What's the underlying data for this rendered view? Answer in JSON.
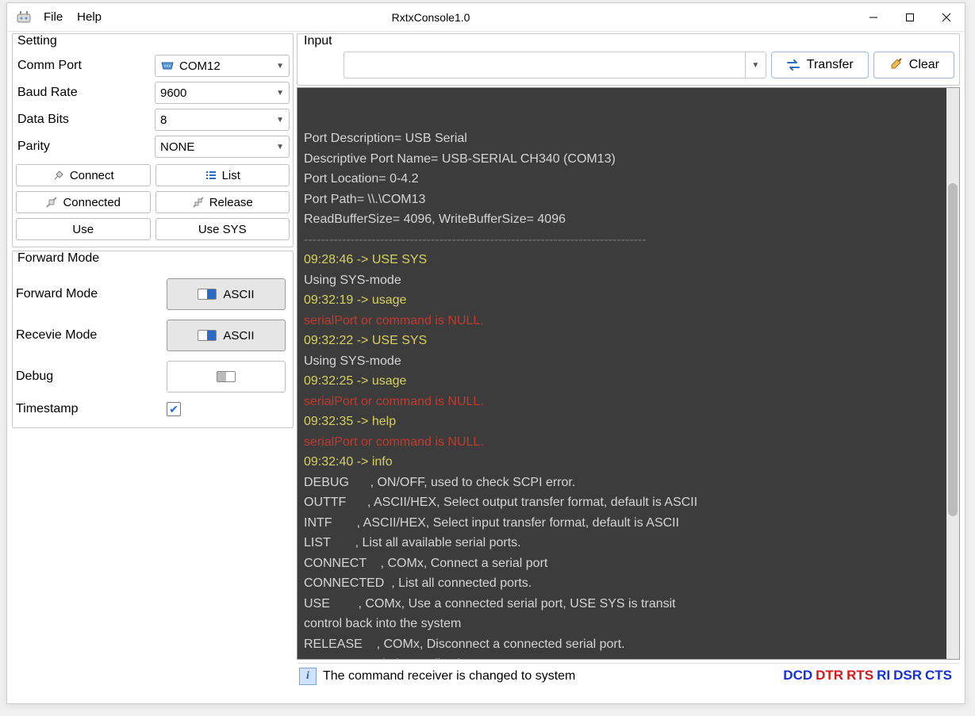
{
  "app": {
    "title": "RxtxConsole1.0"
  },
  "menu": {
    "file": "File",
    "help": "Help"
  },
  "setting": {
    "legend": "Setting",
    "commport_label": "Comm Port",
    "commport_value": "COM12",
    "baud_label": "Baud Rate",
    "baud_value": "9600",
    "databits_label": "Data Bits",
    "databits_value": "8",
    "parity_label": "Parity",
    "parity_value": "NONE",
    "connect": "Connect",
    "list": "List",
    "connected": "Connected",
    "release": "Release",
    "use": "Use",
    "usesys": "Use SYS"
  },
  "forward": {
    "legend": "Forward Mode",
    "fm_label": "Forward Mode",
    "fm_value": "ASCII",
    "rm_label": "Recevie Mode",
    "rm_value": "ASCII",
    "debug_label": "Debug",
    "ts_label": "Timestamp",
    "ts_checked": true
  },
  "input": {
    "legend": "Input",
    "value": "",
    "transfer": "Transfer",
    "clear": "Clear"
  },
  "console_lines": [
    {
      "cls": "cw",
      "text": "Port Description= USB Serial"
    },
    {
      "cls": "cw",
      "text": "Descriptive Port Name= USB-SERIAL CH340 (COM13)"
    },
    {
      "cls": "cw",
      "text": "Port Location= 0-4.2"
    },
    {
      "cls": "cw",
      "text": "Port Path= \\\\.\\COM13"
    },
    {
      "cls": "cw",
      "text": "ReadBufferSize= 4096, WriteBufferSize= 4096"
    },
    {
      "cls": "cg",
      "text": "---------------------------------------------------------------------------------"
    },
    {
      "cls": "cy",
      "text": "09:28:46 -> USE SYS"
    },
    {
      "cls": "cw",
      "text": "Using SYS-mode"
    },
    {
      "cls": "cy",
      "text": "09:32:19 -> usage"
    },
    {
      "cls": "cr",
      "text": "serialPort or command is NULL."
    },
    {
      "cls": "cy",
      "text": "09:32:22 -> USE SYS"
    },
    {
      "cls": "cw",
      "text": "Using SYS-mode"
    },
    {
      "cls": "cy",
      "text": "09:32:25 -> usage"
    },
    {
      "cls": "cr",
      "text": "serialPort or command is NULL."
    },
    {
      "cls": "cy",
      "text": "09:32:35 -> help"
    },
    {
      "cls": "cr",
      "text": "serialPort or command is NULL."
    },
    {
      "cls": "cy",
      "text": "09:32:40 -> info"
    },
    {
      "cls": "cw",
      "text": "DEBUG      , ON/OFF, used to check SCPI error."
    },
    {
      "cls": "cw",
      "text": "OUTTF      , ASCII/HEX, Select output transfer format, default is ASCII"
    },
    {
      "cls": "cw",
      "text": "INTF       , ASCII/HEX, Select input transfer format, default is ASCII"
    },
    {
      "cls": "cw",
      "text": "LIST       , List all available serial ports."
    },
    {
      "cls": "cw",
      "text": "CONNECT    , COMx, Connect a serial port"
    },
    {
      "cls": "cw",
      "text": "CONNECTED  , List all connected ports."
    },
    {
      "cls": "cw",
      "text": "USE        , COMx, Use a connected serial port, USE SYS is transit"
    },
    {
      "cls": "cw",
      "text": "control back into the system"
    },
    {
      "cls": "cw",
      "text": "RELEASE    , COMx, Disconnect a connected serial port."
    },
    {
      "cls": "cw",
      "text": "QUIT       , Quit the application."
    }
  ],
  "status": {
    "msg": "The command receiver is changed to system",
    "signals": [
      {
        "name": "DCD",
        "cls": "blue"
      },
      {
        "name": "DTR",
        "cls": "red"
      },
      {
        "name": "RTS",
        "cls": "red"
      },
      {
        "name": "RI",
        "cls": "blue"
      },
      {
        "name": "DSR",
        "cls": "blue"
      },
      {
        "name": "CTS",
        "cls": "blue"
      }
    ]
  }
}
